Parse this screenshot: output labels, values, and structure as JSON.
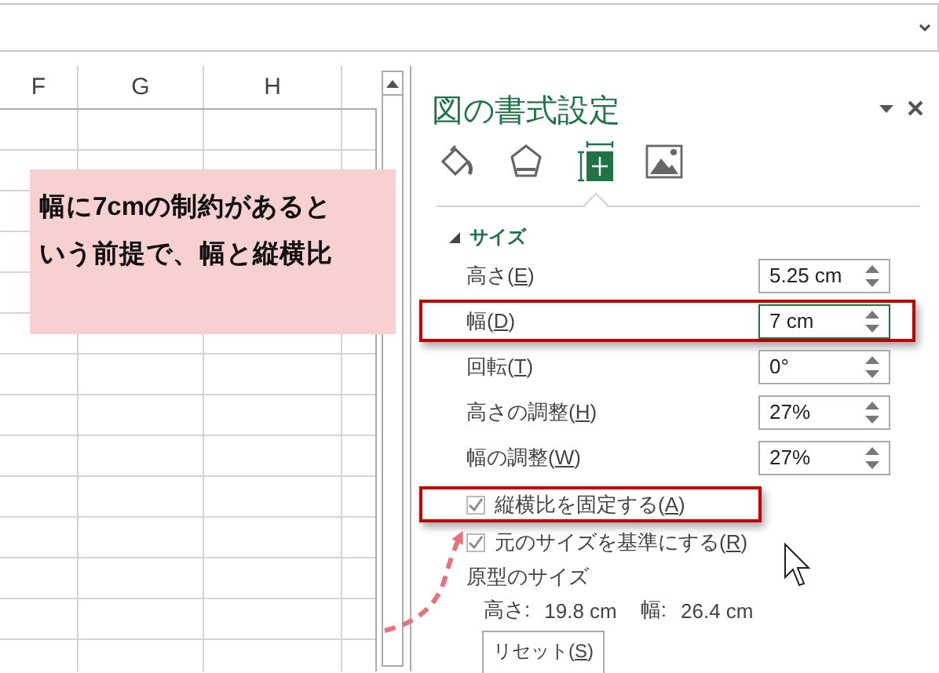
{
  "sheet": {
    "columns": [
      "F",
      "G",
      "H"
    ]
  },
  "note": {
    "lines": [
      "幅に7cmの制約があると",
      "いう前提で、幅と縦横比"
    ]
  },
  "panel": {
    "title": "図の書式設定",
    "tabs": [
      {
        "kind": "fill",
        "selected": false
      },
      {
        "kind": "effects",
        "selected": false
      },
      {
        "kind": "size",
        "selected": true
      },
      {
        "kind": "picture",
        "selected": false
      }
    ],
    "section": {
      "title": "サイズ",
      "expanded": true
    },
    "fields": [
      {
        "label": "高さ(E)",
        "value": "5.25 cm",
        "focused": false,
        "highlighted": false
      },
      {
        "label": "幅(D)",
        "value": "7 cm",
        "focused": true,
        "highlighted": true
      },
      {
        "label": "回転(T)",
        "value": "0°",
        "focused": false,
        "highlighted": false
      },
      {
        "label": "高さの調整(H)",
        "value": "27%",
        "focused": false,
        "highlighted": false
      },
      {
        "label": "幅の調整(W)",
        "value": "27%",
        "focused": false,
        "highlighted": false
      }
    ],
    "checkboxes": [
      {
        "label": "縦横比を固定する(A)",
        "checked": true,
        "highlighted": true
      },
      {
        "label": "元のサイズを基準にする(R)",
        "checked": true,
        "highlighted": false
      }
    ],
    "original_size": {
      "title": "原型のサイズ",
      "height_label": "高さ:",
      "height": "19.8 cm",
      "width_label": "幅:",
      "width": "26.4 cm"
    },
    "reset_button": "リセット(S)"
  }
}
